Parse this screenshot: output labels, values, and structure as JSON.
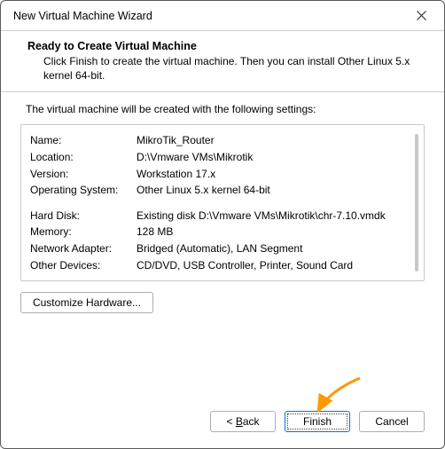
{
  "window": {
    "title": "New Virtual Machine Wizard"
  },
  "header": {
    "heading": "Ready to Create Virtual Machine",
    "subtext": "Click Finish to create the virtual machine. Then you can install Other Linux 5.x kernel 64-bit."
  },
  "intro": "The virtual machine will be created with the following settings:",
  "settings": {
    "group1": [
      {
        "label": "Name:",
        "value": "MikroTik_Router"
      },
      {
        "label": "Location:",
        "value": "D:\\Vmware VMs\\Mikrotik"
      },
      {
        "label": "Version:",
        "value": "Workstation 17.x"
      },
      {
        "label": "Operating System:",
        "value": "Other Linux 5.x kernel 64-bit"
      }
    ],
    "group2": [
      {
        "label": "Hard Disk:",
        "value": "Existing disk D:\\Vmware VMs\\Mikrotik\\chr-7.10.vmdk"
      },
      {
        "label": "Memory:",
        "value": "128 MB"
      },
      {
        "label": "Network Adapter:",
        "value": "Bridged (Automatic), LAN Segment"
      },
      {
        "label": "Other Devices:",
        "value": "CD/DVD, USB Controller, Printer, Sound Card"
      }
    ]
  },
  "buttons": {
    "customize": "Customize Hardware...",
    "back_prefix": "< ",
    "back_letter": "B",
    "back_rest": "ack",
    "finish": "Finish",
    "cancel": "Cancel"
  }
}
